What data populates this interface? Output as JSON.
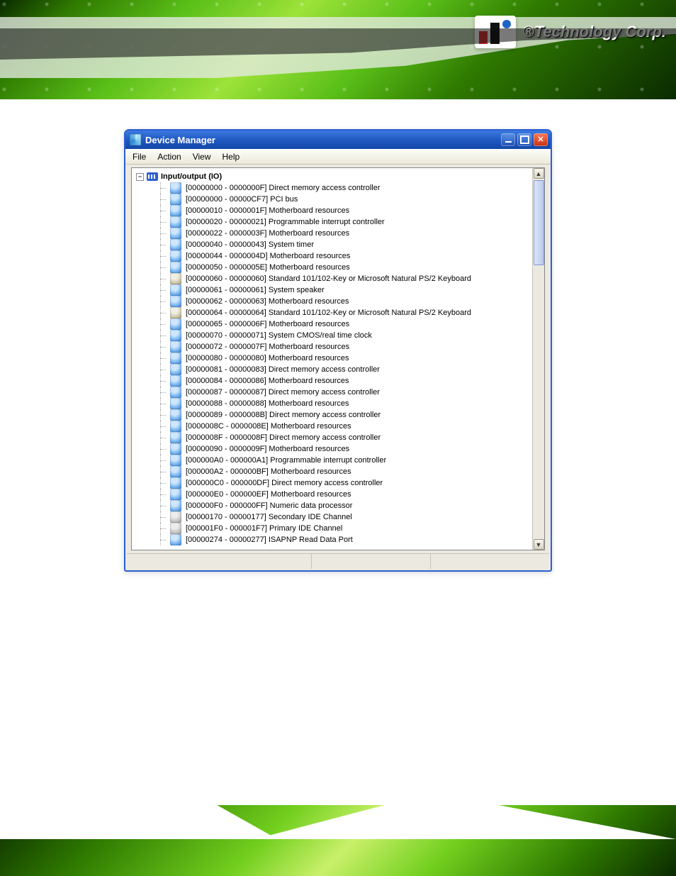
{
  "brand": {
    "registered": "®",
    "text": "Technology Corp."
  },
  "window": {
    "title": "Device Manager",
    "menu": {
      "file": "File",
      "action": "Action",
      "view": "View",
      "help": "Help"
    },
    "root": "Input/output (IO)",
    "items": [
      {
        "label": "[00000000 - 0000000F]  Direct memory access controller",
        "icon": "dev"
      },
      {
        "label": "[00000000 - 00000CF7]  PCI bus",
        "icon": "dev"
      },
      {
        "label": "[00000010 - 0000001F]  Motherboard resources",
        "icon": "dev"
      },
      {
        "label": "[00000020 - 00000021]  Programmable interrupt controller",
        "icon": "dev"
      },
      {
        "label": "[00000022 - 0000003F]  Motherboard resources",
        "icon": "dev"
      },
      {
        "label": "[00000040 - 00000043]  System timer",
        "icon": "dev"
      },
      {
        "label": "[00000044 - 0000004D]  Motherboard resources",
        "icon": "dev"
      },
      {
        "label": "[00000050 - 0000005E]  Motherboard resources",
        "icon": "dev"
      },
      {
        "label": "[00000060 - 00000060]  Standard 101/102-Key or Microsoft Natural PS/2 Keyboard",
        "icon": "kb"
      },
      {
        "label": "[00000061 - 00000061]  System speaker",
        "icon": "dev"
      },
      {
        "label": "[00000062 - 00000063]  Motherboard resources",
        "icon": "dev"
      },
      {
        "label": "[00000064 - 00000064]  Standard 101/102-Key or Microsoft Natural PS/2 Keyboard",
        "icon": "kb"
      },
      {
        "label": "[00000065 - 0000006F]  Motherboard resources",
        "icon": "dev"
      },
      {
        "label": "[00000070 - 00000071]  System CMOS/real time clock",
        "icon": "dev"
      },
      {
        "label": "[00000072 - 0000007F]  Motherboard resources",
        "icon": "dev"
      },
      {
        "label": "[00000080 - 00000080]  Motherboard resources",
        "icon": "dev"
      },
      {
        "label": "[00000081 - 00000083]  Direct memory access controller",
        "icon": "dev"
      },
      {
        "label": "[00000084 - 00000086]  Motherboard resources",
        "icon": "dev"
      },
      {
        "label": "[00000087 - 00000087]  Direct memory access controller",
        "icon": "dev"
      },
      {
        "label": "[00000088 - 00000088]  Motherboard resources",
        "icon": "dev"
      },
      {
        "label": "[00000089 - 0000008B]  Direct memory access controller",
        "icon": "dev"
      },
      {
        "label": "[0000008C - 0000008E]  Motherboard resources",
        "icon": "dev"
      },
      {
        "label": "[0000008F - 0000008F]  Direct memory access controller",
        "icon": "dev"
      },
      {
        "label": "[00000090 - 0000009F]  Motherboard resources",
        "icon": "dev"
      },
      {
        "label": "[000000A0 - 000000A1]  Programmable interrupt controller",
        "icon": "dev"
      },
      {
        "label": "[000000A2 - 000000BF]  Motherboard resources",
        "icon": "dev"
      },
      {
        "label": "[000000C0 - 000000DF]  Direct memory access controller",
        "icon": "dev"
      },
      {
        "label": "[000000E0 - 000000EF]  Motherboard resources",
        "icon": "dev"
      },
      {
        "label": "[000000F0 - 000000FF]  Numeric data processor",
        "icon": "dev"
      },
      {
        "label": "[00000170 - 00000177]  Secondary IDE Channel",
        "icon": "ide"
      },
      {
        "label": "[000001F0 - 000001F7]  Primary IDE Channel",
        "icon": "ide"
      },
      {
        "label": "[00000274 - 00000277]  ISAPNP Read Data Port",
        "icon": "dev"
      }
    ]
  }
}
